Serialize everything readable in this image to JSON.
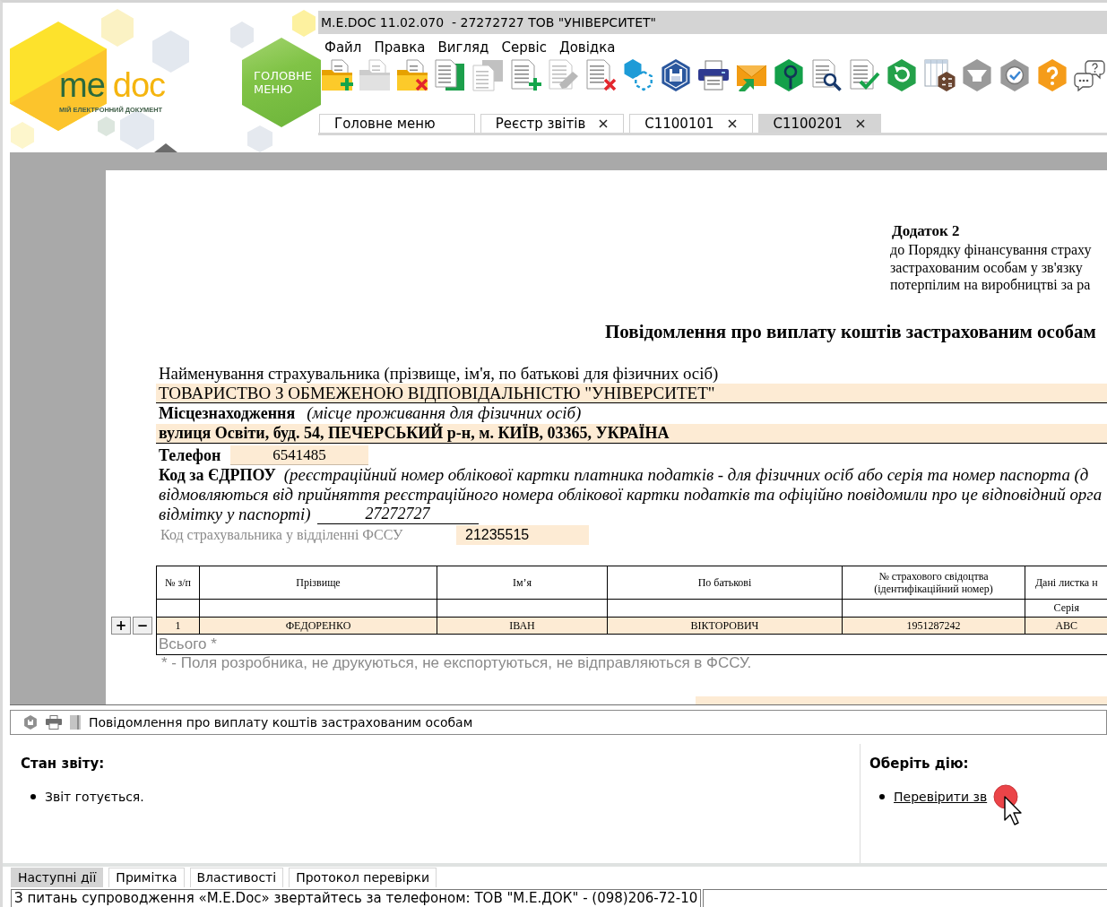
{
  "window": {
    "title": "M.E.DOC 11.02.070  - 27272727 ТОВ \"УНІВЕРСИТЕТ\""
  },
  "logo": {
    "words": [
      "me",
      "doc"
    ],
    "tagline": "МІЙ ЕЛЕКТРОННИЙ ДОКУМЕНТ"
  },
  "main_menu_button": "ГОЛОВНЕ МЕНЮ",
  "menu": [
    "Файл",
    "Правка",
    "Вигляд",
    "Сервіс",
    "Довідка"
  ],
  "toolbar": [
    {
      "kind": "newfolder",
      "disabled": false
    },
    {
      "kind": "open",
      "disabled": true
    },
    {
      "kind": "deletefolder",
      "disabled": false
    },
    {
      "kind": "documents",
      "disabled": false
    },
    {
      "kind": "copies",
      "disabled": true
    },
    {
      "kind": "adddoc",
      "disabled": false
    },
    {
      "kind": "editdoc",
      "disabled": true
    },
    {
      "kind": "deletedoc",
      "disabled": false
    },
    {
      "kind": "exchange",
      "disabled": false
    },
    {
      "kind": "save",
      "disabled": false
    },
    {
      "kind": "print",
      "disabled": false
    },
    {
      "kind": "send",
      "disabled": false
    },
    {
      "kind": "find",
      "disabled": false
    },
    {
      "kind": "preview",
      "disabled": false
    },
    {
      "kind": "check",
      "disabled": false
    },
    {
      "kind": "refresh",
      "disabled": false
    },
    {
      "kind": "calc",
      "disabled": false
    },
    {
      "kind": "filter",
      "disabled": false
    },
    {
      "kind": "verify",
      "disabled": false
    },
    {
      "kind": "help",
      "disabled": false
    },
    {
      "kind": "chat",
      "disabled": false
    }
  ],
  "tabs": [
    {
      "label": "Головне меню",
      "closable": false,
      "selected": false
    },
    {
      "label": "Реєстр звітів",
      "closable": true,
      "selected": false
    },
    {
      "label": "C1100101",
      "closable": true,
      "selected": false
    },
    {
      "label": "C1100201",
      "closable": true,
      "selected": true
    }
  ],
  "document": {
    "appendix_title": "Додаток 2",
    "appendix_lines": [
      "до Порядку фінансування страху",
      "застрахованим особам у зв'язку",
      "потерпілим на виробництві за ра"
    ],
    "title": "Повідомлення про виплату коштів застрахованим особам",
    "insurer": {
      "label": "Найменування страхувальника (прізвище, ім'я, по батькові для фізичних осіб)",
      "value": "ТОВАРИСТВО З ОБМЕЖЕНОЮ ВІДПОВІДАЛЬНІСТЮ \"УНІВЕРСИТЕТ\""
    },
    "location": {
      "label": "Місцезнаходження",
      "hint": "(місце проживання для фізичних осіб)",
      "value": "вулиця Освіти, буд. 54, ПЕЧЕРСЬКИЙ р-н, м. КИЇВ, 03365, УКРАЇНА"
    },
    "phone": {
      "label": "Телефон",
      "value": "6541485"
    },
    "edrpou": {
      "label": "Код за ЄДРПОУ",
      "hint_lines": [
        "(реєстраційний номер облікової картки платника податків - для фізичних осіб або серія та номер паспорта (д",
        "відмовляються від прийняття реєстраційного номера облікової картки податків та офіційно повідомили про це відповідний орга",
        "відмітку у паспорті)"
      ],
      "value": "27272727"
    },
    "fssu_code": {
      "label": "Код страхувальника у відділенні ФССУ",
      "value": "21235515"
    },
    "row_buttons": [
      "+",
      "−"
    ],
    "table": {
      "columns": [
        "№ з/п",
        "Прізвище",
        "Ім’я",
        "По батькові",
        "№ страхового свідоцтва (ідентифікаційний номер)",
        "Дані листка н"
      ],
      "last_column_subheader": "Серія",
      "rows": [
        [
          "1",
          "ФЕДОРЕНКО",
          "ІВАН",
          "ВІКТОРОВИЧ",
          "1951287242",
          "АВС"
        ]
      ],
      "total_label": "Всього *"
    },
    "footnote": "* - Поля розробника, не друкуються, не експортуються, не відправляються в ФССУ."
  },
  "document_bar": {
    "title": "Повідомлення про виплату коштів застрахованим особам"
  },
  "report_status": {
    "heading": "Стан звіту:",
    "items": [
      "Звіт готується."
    ]
  },
  "actions": {
    "heading": "Оберіть дію:",
    "links": [
      "Перевірити зв"
    ]
  },
  "bottom_tabs": [
    {
      "label": "Наступні дії",
      "selected": true
    },
    {
      "label": "Примітка",
      "selected": false
    },
    {
      "label": "Властивості",
      "selected": false
    },
    {
      "label": "Протокол перевірки",
      "selected": false
    }
  ],
  "status_bar": {
    "message": "З питань супроводження «M.E.Doc» звертайтесь за телефоном: ТОВ \"М.Е.ДОК\" - (098)206-72-10"
  }
}
